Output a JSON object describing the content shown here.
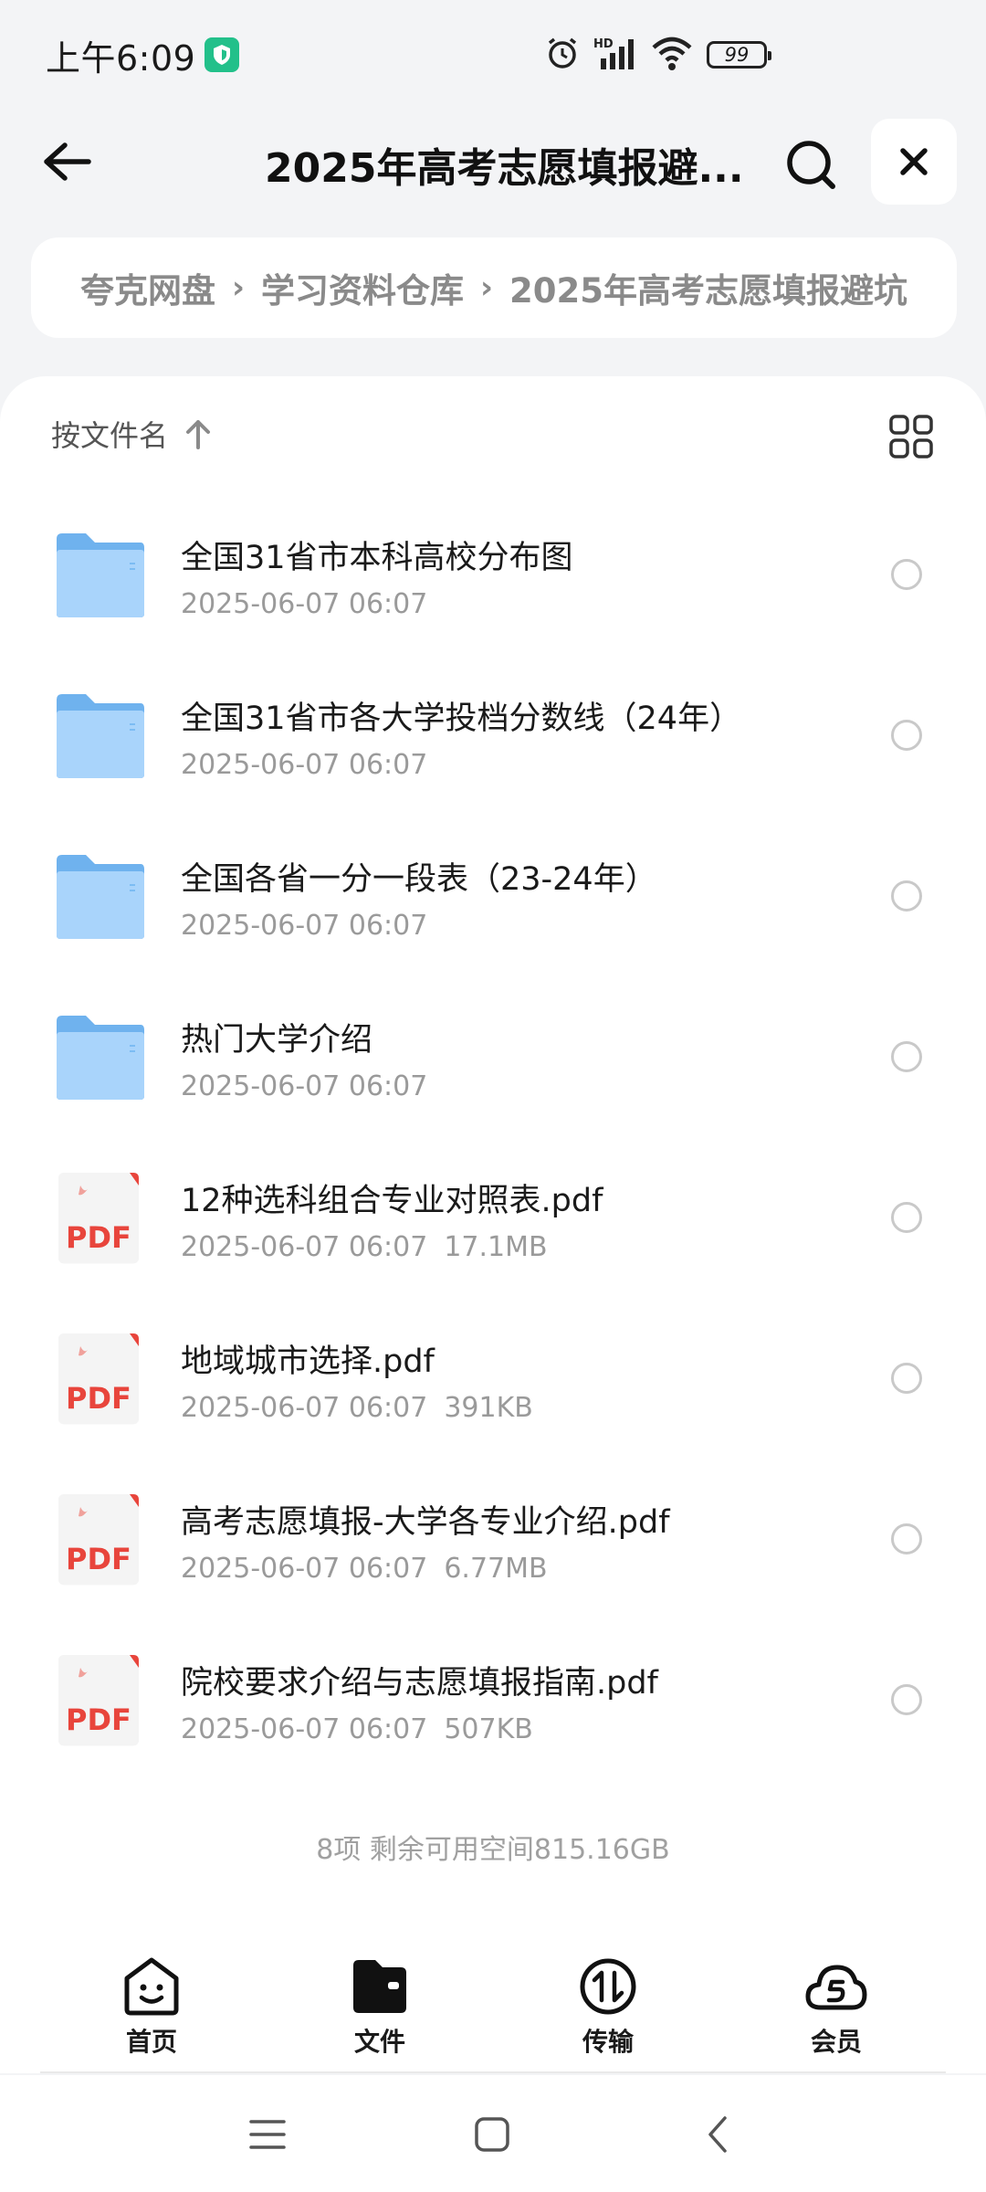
{
  "status": {
    "time": "上午6:09",
    "battery": "99",
    "network": "HD"
  },
  "header": {
    "title": "2025年高考志愿填报避..."
  },
  "breadcrumb": {
    "items": [
      "夸克网盘",
      "学习资料仓库",
      "2025年高考志愿填报避坑"
    ]
  },
  "toolbar": {
    "sort_label": "按文件名"
  },
  "files": [
    {
      "name": "全国31省市本科高校分布图",
      "date": "2025-06-07 06:07",
      "size": "",
      "type": "folder"
    },
    {
      "name": "全国31省市各大学投档分数线（24年）",
      "date": "2025-06-07 06:07",
      "size": "",
      "type": "folder"
    },
    {
      "name": "全国各省一分一段表（23-24年）",
      "date": "2025-06-07 06:07",
      "size": "",
      "type": "folder"
    },
    {
      "name": "热门大学介绍",
      "date": "2025-06-07 06:07",
      "size": "",
      "type": "folder"
    },
    {
      "name": "12种选科组合专业对照表.pdf",
      "date": "2025-06-07 06:07",
      "size": "17.1MB",
      "type": "pdf"
    },
    {
      "name": "地域城市选择.pdf",
      "date": "2025-06-07 06:07",
      "size": "391KB",
      "type": "pdf"
    },
    {
      "name": "高考志愿填报-大学各专业介绍.pdf",
      "date": "2025-06-07 06:07",
      "size": "6.77MB",
      "type": "pdf"
    },
    {
      "name": "院校要求介绍与志愿填报指南.pdf",
      "date": "2025-06-07 06:07",
      "size": "507KB",
      "type": "pdf"
    }
  ],
  "pdf_badge": "PDF",
  "footer": {
    "summary": "8项 剩余可用空间815.16GB"
  },
  "nav": {
    "home": "首页",
    "files": "文件",
    "transfer": "传输",
    "member": "会员"
  },
  "colors": {
    "folder": "#7cbcf3",
    "pdf_red": "#e8453c",
    "background": "#f3f4f6"
  }
}
